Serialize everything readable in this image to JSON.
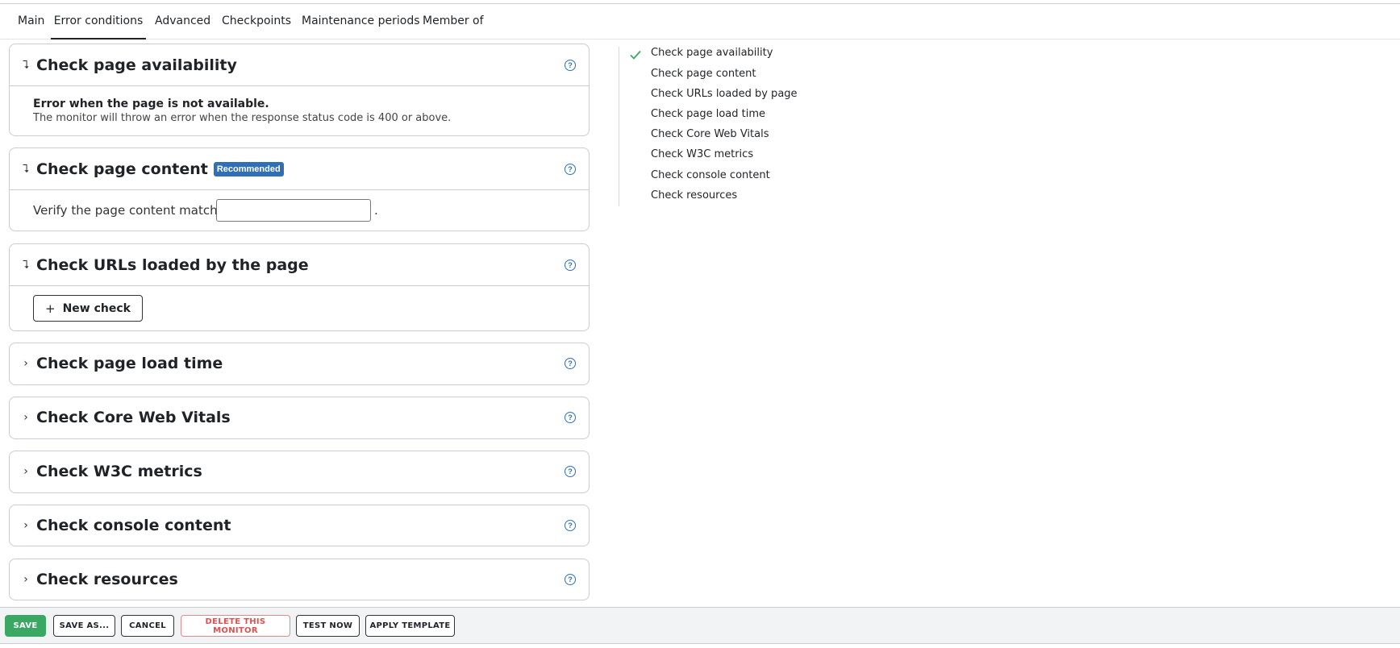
{
  "tabs": [
    {
      "label": "Main"
    },
    {
      "label": "Error conditions",
      "active": true
    },
    {
      "label": "Advanced"
    },
    {
      "label": "Checkpoints"
    },
    {
      "label": "Maintenance periods"
    },
    {
      "label": "Member of"
    }
  ],
  "panels": {
    "availability": {
      "title": "Check page availability",
      "expanded": true,
      "error_title": "Error when the page is not available.",
      "error_desc": "The monitor will throw an error when the response status code is 400 or above."
    },
    "content": {
      "title": "Check page content",
      "badge": "Recommended",
      "expanded": true,
      "verify_label": "Verify the page content matches",
      "verify_value": "",
      "verify_suffix": "."
    },
    "urls": {
      "title": "Check URLs loaded by the page",
      "expanded": true,
      "new_check_label": "New check"
    },
    "load_time": {
      "title": "Check page load time",
      "expanded": false
    },
    "web_vitals": {
      "title": "Check Core Web Vitals",
      "expanded": false
    },
    "w3c": {
      "title": "Check W3C metrics",
      "expanded": false
    },
    "console": {
      "title": "Check console content",
      "expanded": false
    },
    "resources": {
      "title": "Check resources",
      "expanded": false
    }
  },
  "sidenav": {
    "items": [
      {
        "label": "Check page availability",
        "checked": true
      },
      {
        "label": "Check page content",
        "checked": false
      },
      {
        "label": "Check URLs loaded by page",
        "checked": false
      },
      {
        "label": "Check page load time",
        "checked": false
      },
      {
        "label": "Check Core Web Vitals",
        "checked": false
      },
      {
        "label": "Check W3C metrics",
        "checked": false
      },
      {
        "label": "Check console content",
        "checked": false
      },
      {
        "label": "Check resources",
        "checked": false
      }
    ]
  },
  "footer": {
    "save": "SAVE",
    "save_as": "SAVE AS...",
    "cancel": "CANCEL",
    "delete": "DELETE THIS MONITOR",
    "test_now": "TEST NOW",
    "apply_template": "APPLY TEMPLATE"
  },
  "icons": {
    "expanded": "collapse-toggle-icon",
    "collapsed": "chevron-right-icon",
    "help": "help-circle-icon",
    "check": "check-icon",
    "plus": "plus-icon"
  },
  "colors": {
    "accent": "#2f6fb8",
    "save": "#3aa862",
    "danger": "#e05050",
    "check": "#3aa862"
  }
}
